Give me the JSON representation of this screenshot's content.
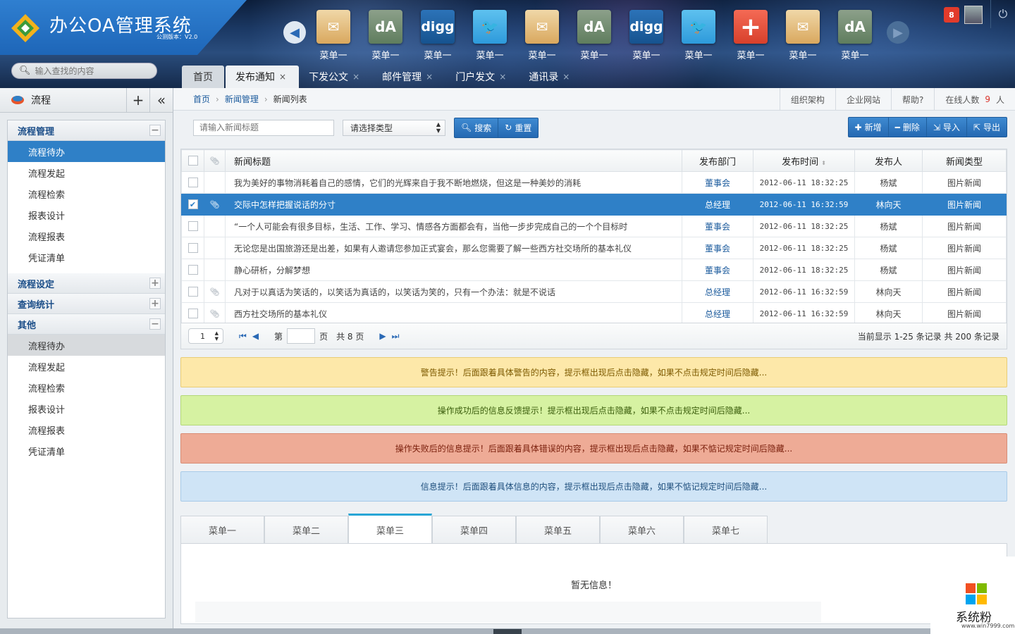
{
  "app": {
    "title": "办公OA管理系统",
    "version": "公测版本：V2.0"
  },
  "search": {
    "placeholder": "输入查找的内容"
  },
  "apps": [
    {
      "icon": "mail-icon",
      "label": "菜单一",
      "style": "mail",
      "glyph": "✉"
    },
    {
      "icon": "deviantart-icon",
      "label": "菜单一",
      "style": "da",
      "glyph": "dA"
    },
    {
      "icon": "digg-icon",
      "label": "菜单一",
      "style": "digg",
      "glyph": "digg"
    },
    {
      "icon": "twitter-icon",
      "label": "菜单一",
      "style": "tw",
      "glyph": "🐦"
    },
    {
      "icon": "mail-icon",
      "label": "菜单一",
      "style": "mail",
      "glyph": "✉"
    },
    {
      "icon": "deviantart-icon",
      "label": "菜单一",
      "style": "da",
      "glyph": "dA"
    },
    {
      "icon": "digg-icon",
      "label": "菜单一",
      "style": "digg",
      "glyph": "digg"
    },
    {
      "icon": "twitter-icon",
      "label": "菜单一",
      "style": "tw",
      "glyph": "🐦"
    },
    {
      "icon": "plus-icon",
      "label": "菜单一",
      "style": "plus",
      "glyph": "+"
    },
    {
      "icon": "mail-icon",
      "label": "菜单一",
      "style": "mail",
      "glyph": "✉"
    },
    {
      "icon": "deviantart-icon",
      "label": "菜单一",
      "style": "da",
      "glyph": "dA"
    }
  ],
  "topbar": {
    "notifications": "8"
  },
  "tabs": {
    "home": "首页",
    "items": [
      {
        "label": "发布通知",
        "active": true
      },
      {
        "label": "下发公文"
      },
      {
        "label": "邮件管理"
      },
      {
        "label": "门户发文"
      },
      {
        "label": "通讯录"
      }
    ]
  },
  "sidebar": {
    "title": "流程",
    "groups": [
      {
        "label": "流程管理",
        "expanded": true,
        "items": [
          "流程待办",
          "流程发起",
          "流程检索",
          "报表设计",
          "流程报表",
          "凭证清单"
        ],
        "selected": 0
      },
      {
        "label": "流程设定",
        "expanded": false,
        "items": []
      },
      {
        "label": "查询统计",
        "expanded": false,
        "items": []
      },
      {
        "label": "其他",
        "expanded": true,
        "items": [
          "流程待办",
          "流程发起",
          "流程检索",
          "报表设计",
          "流程报表",
          "凭证清单"
        ],
        "highlighted": 0
      }
    ]
  },
  "breadcrumb": [
    "首页",
    "新闻管理",
    "新闻列表"
  ],
  "headerlinks": {
    "org": "组织架构",
    "site": "企业网站",
    "help": "帮助?",
    "online_label": "在线人数",
    "online_count": "9",
    "online_unit": "人"
  },
  "filters": {
    "title_placeholder": "请输入新闻标题",
    "type_select": "请选择类型",
    "search": "搜索",
    "reset": "重置"
  },
  "actions": {
    "add": "新增",
    "delete": "删除",
    "import": "导入",
    "export": "导出"
  },
  "table": {
    "columns": [
      "新闻标题",
      "发布部门",
      "发布时间",
      "发布人",
      "新闻类型"
    ],
    "rows": [
      {
        "title": "我为美好的事物消耗着自己的感情，它们的光辉来自于我不断地燃烧，但这是一种美妙的消耗",
        "dept": "董事会",
        "time": "2012-06-11 18:32:25",
        "author": "杨斌",
        "type": "图片新闻",
        "clip": false,
        "checked": false
      },
      {
        "title": "交际中怎样把握说话的分寸",
        "dept": "总经理",
        "time": "2012-06-11 16:32:59",
        "author": "林向天",
        "type": "图片新闻",
        "clip": true,
        "checked": true
      },
      {
        "title": "“一个人可能会有很多目标，生活、工作、学习、情感各方面都会有，当他一步步完成自己的一个个目标时",
        "dept": "董事会",
        "time": "2012-06-11 18:32:25",
        "author": "杨斌",
        "type": "图片新闻",
        "clip": false,
        "checked": false
      },
      {
        "title": "无论您是出国旅游还是出差，如果有人邀请您参加正式宴会，那么您需要了解一些西方社交场所的基本礼仪",
        "dept": "董事会",
        "time": "2012-06-11 18:32:25",
        "author": "杨斌",
        "type": "图片新闻",
        "clip": false,
        "checked": false
      },
      {
        "title": "静心研析，分解梦想",
        "dept": "董事会",
        "time": "2012-06-11 18:32:25",
        "author": "杨斌",
        "type": "图片新闻",
        "clip": false,
        "checked": false
      },
      {
        "title": "凡对于以真话为笑话的，以笑话为真话的，以笑话为笑的，只有一个办法：就是不说话",
        "dept": "总经理",
        "time": "2012-06-11 16:32:59",
        "author": "林向天",
        "type": "图片新闻",
        "clip": true,
        "checked": false
      },
      {
        "title": "西方社交场所的基本礼仪",
        "dept": "总经理",
        "time": "2012-06-11 16:32:59",
        "author": "林向天",
        "type": "图片新闻",
        "clip": true,
        "checked": false
      }
    ]
  },
  "pager": {
    "page_size": "1",
    "page_label_before": "第",
    "page_label_after": "页",
    "total_pages": "共 8 页",
    "info": "当前显示 1-25 条记录 共 200 条记录"
  },
  "alerts": {
    "warning": "警告提示！后面跟着具体警告的内容，提示框出现后点击隐藏，如果不点击规定时间后隐藏...",
    "success": "操作成功后的信息反馈提示！提示框出现后点击隐藏，如果不点击规定时间后隐藏...",
    "error": "操作失败后的信息提示！后面跟着具体错误的内容，提示框出现后点击隐藏，如果不惦记规定时间后隐藏...",
    "info": "信息提示！后面跟着具体信息的内容，提示框出现后点击隐藏，如果不惦记规定时间后隐藏..."
  },
  "bottom_tabs": {
    "items": [
      "菜单一",
      "菜单二",
      "菜单三",
      "菜单四",
      "菜单五",
      "菜单六",
      "菜单七"
    ],
    "active": 2,
    "empty": "暂无信息！"
  },
  "watermark": {
    "name": "系统粉",
    "url": "www.win7999.com"
  }
}
